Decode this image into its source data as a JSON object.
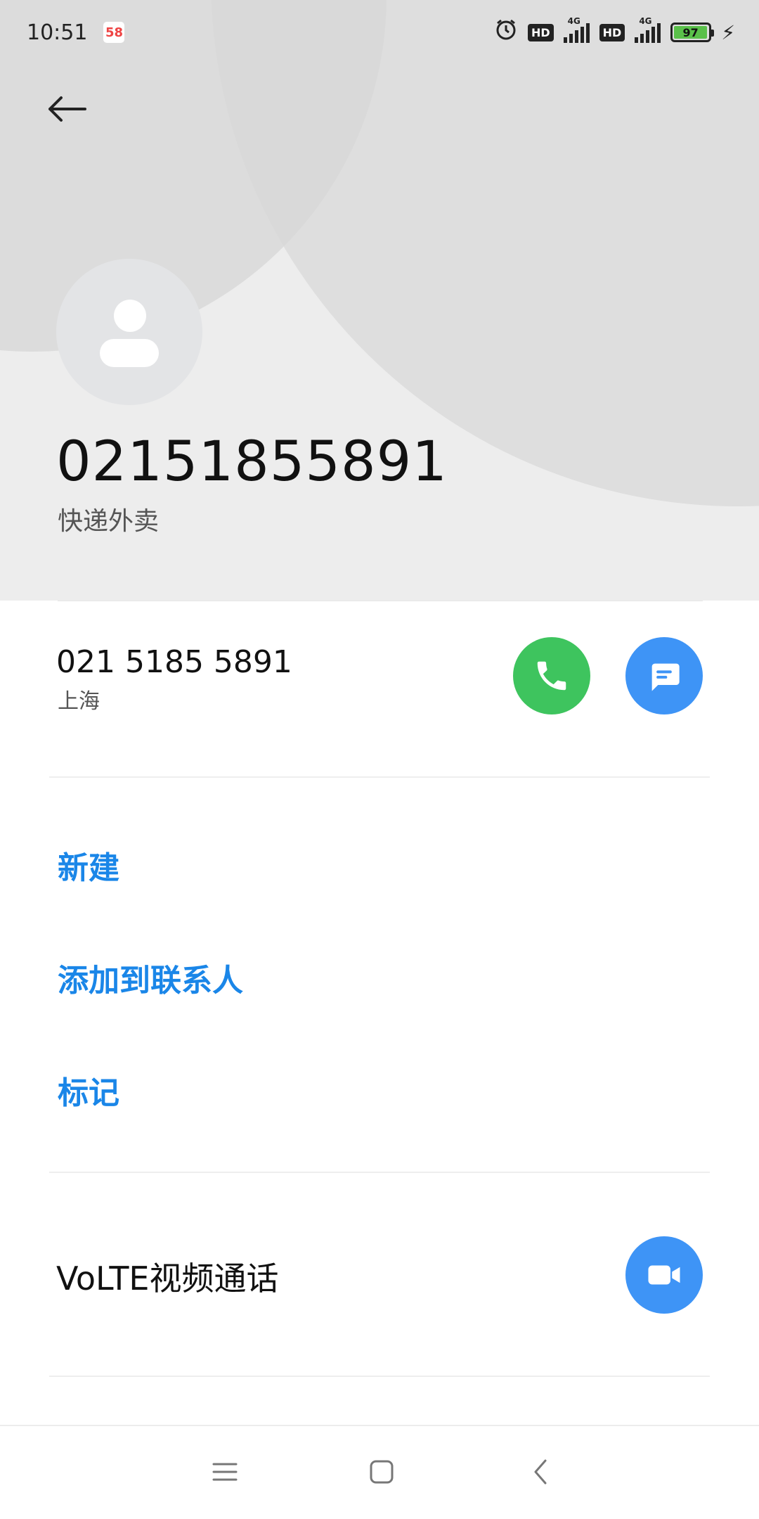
{
  "status_bar": {
    "time": "10:51",
    "app_badge": "58",
    "network_1": "4G",
    "network_2": "4G",
    "hd_1": "HD",
    "hd_2": "HD",
    "battery": "97",
    "battery_level": 0.97
  },
  "contact": {
    "name": "02151855891",
    "tag": "快递外卖"
  },
  "number": {
    "formatted": "021 5185 5891",
    "location": "上海"
  },
  "actions": {
    "new": "新建",
    "add_to_contacts": "添加到联系人",
    "mark": "标记"
  },
  "volte": {
    "label": "VoLTE视频通话"
  },
  "colors": {
    "accent_blue": "#1a86e8",
    "call_green": "#3ec45e",
    "button_blue": "#3e94f6"
  },
  "icons": {
    "back": "arrow-left-icon",
    "call": "phone-icon",
    "message": "message-icon",
    "video": "video-camera-icon",
    "menu": "menu-icon",
    "home": "home-square-icon",
    "nav_back": "chevron-left-icon"
  }
}
